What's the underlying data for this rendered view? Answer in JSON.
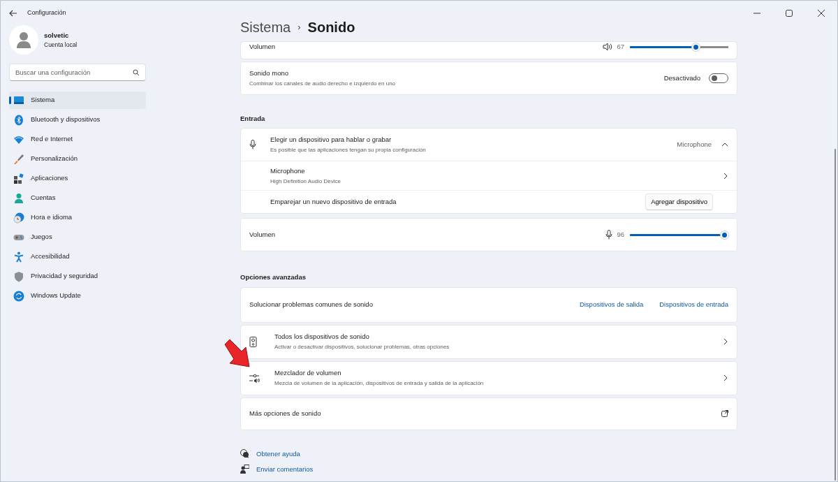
{
  "window": {
    "title": "Configuración"
  },
  "account": {
    "name": "solvetic",
    "type": "Cuenta local"
  },
  "search": {
    "placeholder": "Buscar una configuración"
  },
  "sidebar": {
    "items": [
      {
        "label": "Sistema",
        "kind": "system",
        "selected": true
      },
      {
        "label": "Bluetooth y dispositivos",
        "kind": "bluetooth",
        "selected": false
      },
      {
        "label": "Red e Internet",
        "kind": "wifi",
        "selected": false
      },
      {
        "label": "Personalización",
        "kind": "brush",
        "selected": false
      },
      {
        "label": "Aplicaciones",
        "kind": "apps",
        "selected": false
      },
      {
        "label": "Cuentas",
        "kind": "person",
        "selected": false
      },
      {
        "label": "Hora e idioma",
        "kind": "clock",
        "selected": false
      },
      {
        "label": "Juegos",
        "kind": "gamepad",
        "selected": false
      },
      {
        "label": "Accesibilidad",
        "kind": "accessibility",
        "selected": false
      },
      {
        "label": "Privacidad y seguridad",
        "kind": "shield",
        "selected": false
      },
      {
        "label": "Windows Update",
        "kind": "update",
        "selected": false
      }
    ]
  },
  "breadcrumb": {
    "parent": "Sistema",
    "separator": "›",
    "current": "Sonido"
  },
  "output_volume": {
    "label": "Volumen",
    "reading": "67",
    "level": 0.67
  },
  "mono": {
    "title": "Sonido mono",
    "description": "Combinar los canales de audio derecho e izquierdo en uno",
    "state_label": "Desactivado",
    "on": false
  },
  "input_heading": "Entrada",
  "input": {
    "chooser": {
      "title": "Elegir un dispositivo para hablar o grabar",
      "description": "Es posible que las aplicaciones tengan su propia configuración",
      "value": "Microphone",
      "expanded": true
    },
    "device": {
      "name": "Microphone",
      "description": "High Definition Audio Device"
    },
    "pair": {
      "label": "Emparejar un nuevo dispositivo de entrada",
      "button": "Agregar dispositivo"
    }
  },
  "input_volume": {
    "label": "Volumen",
    "reading": "96",
    "level": 0.96
  },
  "advanced_heading": "Opciones avanzadas",
  "troubleshoot": {
    "label": "Solucionar problemas comunes de sonido",
    "links": [
      "Dispositivos de salida",
      "Dispositivos de entrada"
    ]
  },
  "advanced_items": [
    {
      "kind": "speaker",
      "title": "Todos los dispositivos de sonido",
      "description": "Activar o desactivar dispositivos, solucionar problemas, otras opciones"
    },
    {
      "kind": "mixer",
      "title": "Mezclador de volumen",
      "description": "Mezcla de volumen de la aplicación, dispositivos de entrada y salida de la aplicación"
    }
  ],
  "more": {
    "label": "Más opciones de sonido"
  },
  "footer_links": [
    {
      "kind": "help",
      "label": "Obtener ayuda"
    },
    {
      "kind": "feedback",
      "label": "Enviar comentarios"
    }
  ]
}
